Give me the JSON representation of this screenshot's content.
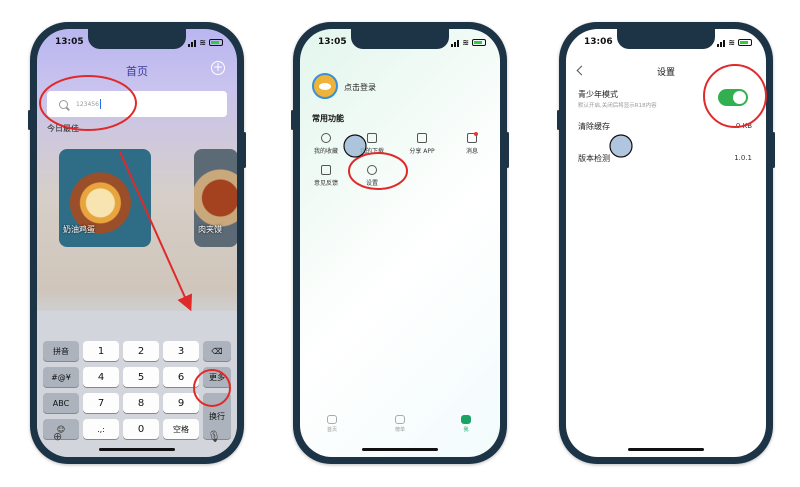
{
  "phone1": {
    "time": "13:05",
    "title": "首页",
    "search_value": "123456",
    "section_label": "今日最佳",
    "card_main_caption": "奶油鸡蛋",
    "card_side_caption": "肉夹馍",
    "keyboard": {
      "row1": [
        "拼音",
        "1",
        "2",
        "3"
      ],
      "row2": [
        "#@¥",
        "4",
        "5",
        "6",
        "更多"
      ],
      "row3": [
        "ABC",
        "7",
        "8",
        "9"
      ],
      "row4": [
        ".,:",
        "0",
        "空格"
      ],
      "enter": "换行"
    }
  },
  "phone2": {
    "time": "13:05",
    "login": "点击登录",
    "section_title": "常用功能",
    "functions": [
      "我的收藏",
      "我的下载",
      "分享 APP",
      "消息",
      "意见反馈",
      "设置"
    ],
    "tabs": [
      "首页",
      "榜单",
      "我"
    ]
  },
  "phone3": {
    "time": "13:06",
    "title": "设置",
    "youth_mode": "青少年模式",
    "youth_desc": "默认开启,关闭后将显示R18内容",
    "youth_enabled": true,
    "clear_cache": "清除缓存",
    "cache_size": "0 KB",
    "version_check": "版本检测",
    "version": "1.0.1"
  },
  "colors": {
    "accent_green": "#32b04f",
    "annotation_red": "#e02a2a",
    "phone_frame": "#1d3446"
  }
}
